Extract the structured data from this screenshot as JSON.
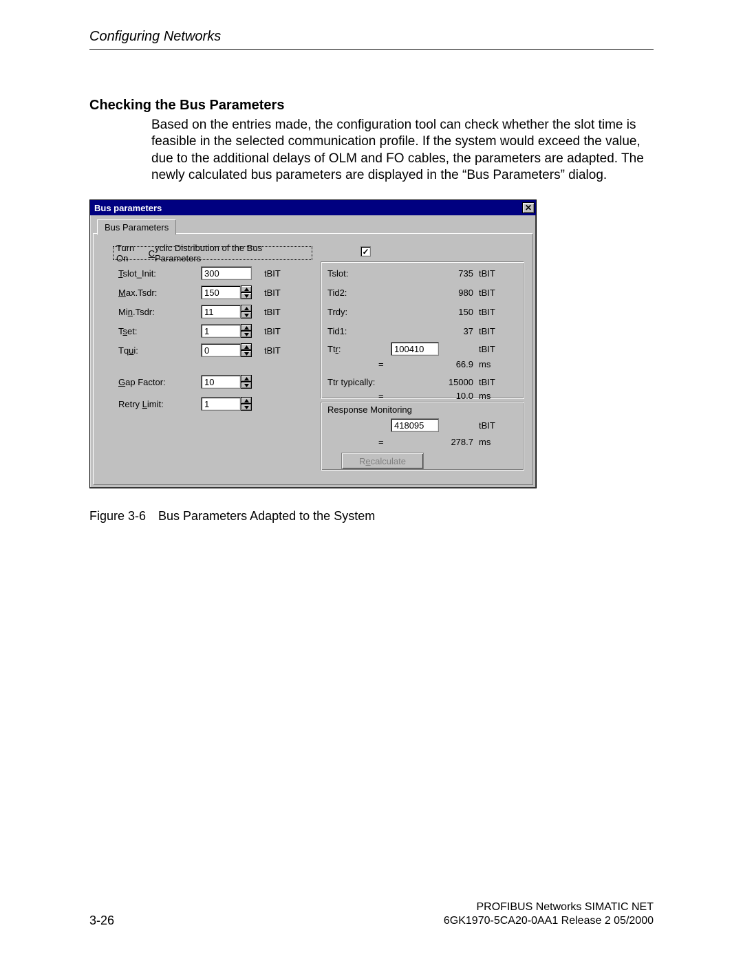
{
  "page_header": "Configuring Networks",
  "section_heading": "Checking the Bus Parameters",
  "body_paragraph": "Based on the entries made, the configuration tool can check whether the slot time is feasible in the selected communication profile. If the system would exceed the value, due to the additional delays of OLM and FO cables, the parameters are adapted. The newly calculated bus parameters are displayed in the “Bus Parameters” dialog.",
  "dialog": {
    "title": "Bus parameters",
    "tab_label": "Bus Parameters",
    "cyclic_label_pre": "Turn On ",
    "cyclic_label_u": "C",
    "cyclic_label_post": "yclic Distribution of the Bus Parameters",
    "cyclic_checked": "✓",
    "left": {
      "tslot_init": {
        "label_pre": "",
        "label_u": "T",
        "label_post": "slot_Init:",
        "value": "300",
        "unit": "tBIT",
        "spinner": false
      },
      "max_tsdr": {
        "label_pre": "",
        "label_u": "M",
        "label_post": "ax.Tsdr:",
        "value": "150",
        "unit": "tBIT",
        "spinner": true
      },
      "min_tsdr": {
        "label_pre": "Mi",
        "label_u": "n",
        "label_post": ".Tsdr:",
        "value": "11",
        "unit": "tBIT",
        "spinner": true
      },
      "tset": {
        "label_pre": "T",
        "label_u": "s",
        "label_post": "et:",
        "value": "1",
        "unit": "tBIT",
        "spinner": true
      },
      "tqui": {
        "label_pre": "Tq",
        "label_u": "u",
        "label_post": "i:",
        "value": "0",
        "unit": "tBIT",
        "spinner": true
      },
      "gap": {
        "label_pre": "",
        "label_u": "G",
        "label_post": "ap Factor:",
        "value": "10",
        "unit": "",
        "spinner": true
      },
      "retry": {
        "label_pre": "Retry ",
        "label_u": "L",
        "label_post": "imit:",
        "value": "1",
        "unit": "",
        "spinner": true
      }
    },
    "right": {
      "tslot": {
        "label": "Tslot:",
        "value": "735",
        "unit": "tBIT"
      },
      "tid2": {
        "label": "Tid2:",
        "value": "980",
        "unit": "tBIT"
      },
      "trdy": {
        "label": "Trdy:",
        "value": "150",
        "unit": "tBIT"
      },
      "tid1": {
        "label": "Tid1:",
        "value": "37",
        "unit": "tBIT"
      },
      "ttr": {
        "label_pre": "Tt",
        "label_u": "r",
        "label_post": ":",
        "value": "100410",
        "unit": "tBIT"
      },
      "ttr_eq": {
        "label": "=",
        "value": "66.9",
        "unit": "ms"
      },
      "ttr_typ": {
        "label": "Ttr typically:",
        "value": "15000",
        "unit": "tBIT"
      },
      "ttr_typ_eq": {
        "label": "=",
        "value": "10.0",
        "unit": "ms"
      },
      "resp_header": "Response Monitoring",
      "resp": {
        "value": "418095",
        "unit": "tBIT"
      },
      "resp_eq": {
        "label": "=",
        "value": "278.7",
        "unit": "ms"
      },
      "recalc_pre": "R",
      "recalc_u": "e",
      "recalc_post": "calculate"
    }
  },
  "figure_caption": "Figure 3-6 Bus Parameters Adapted to the System",
  "footer_right_line1": "PROFIBUS Networks SIMATIC NET",
  "footer_right_line2": "6GK1970-5CA20-0AA1 Release 2 05/2000",
  "footer_left": "3-26"
}
